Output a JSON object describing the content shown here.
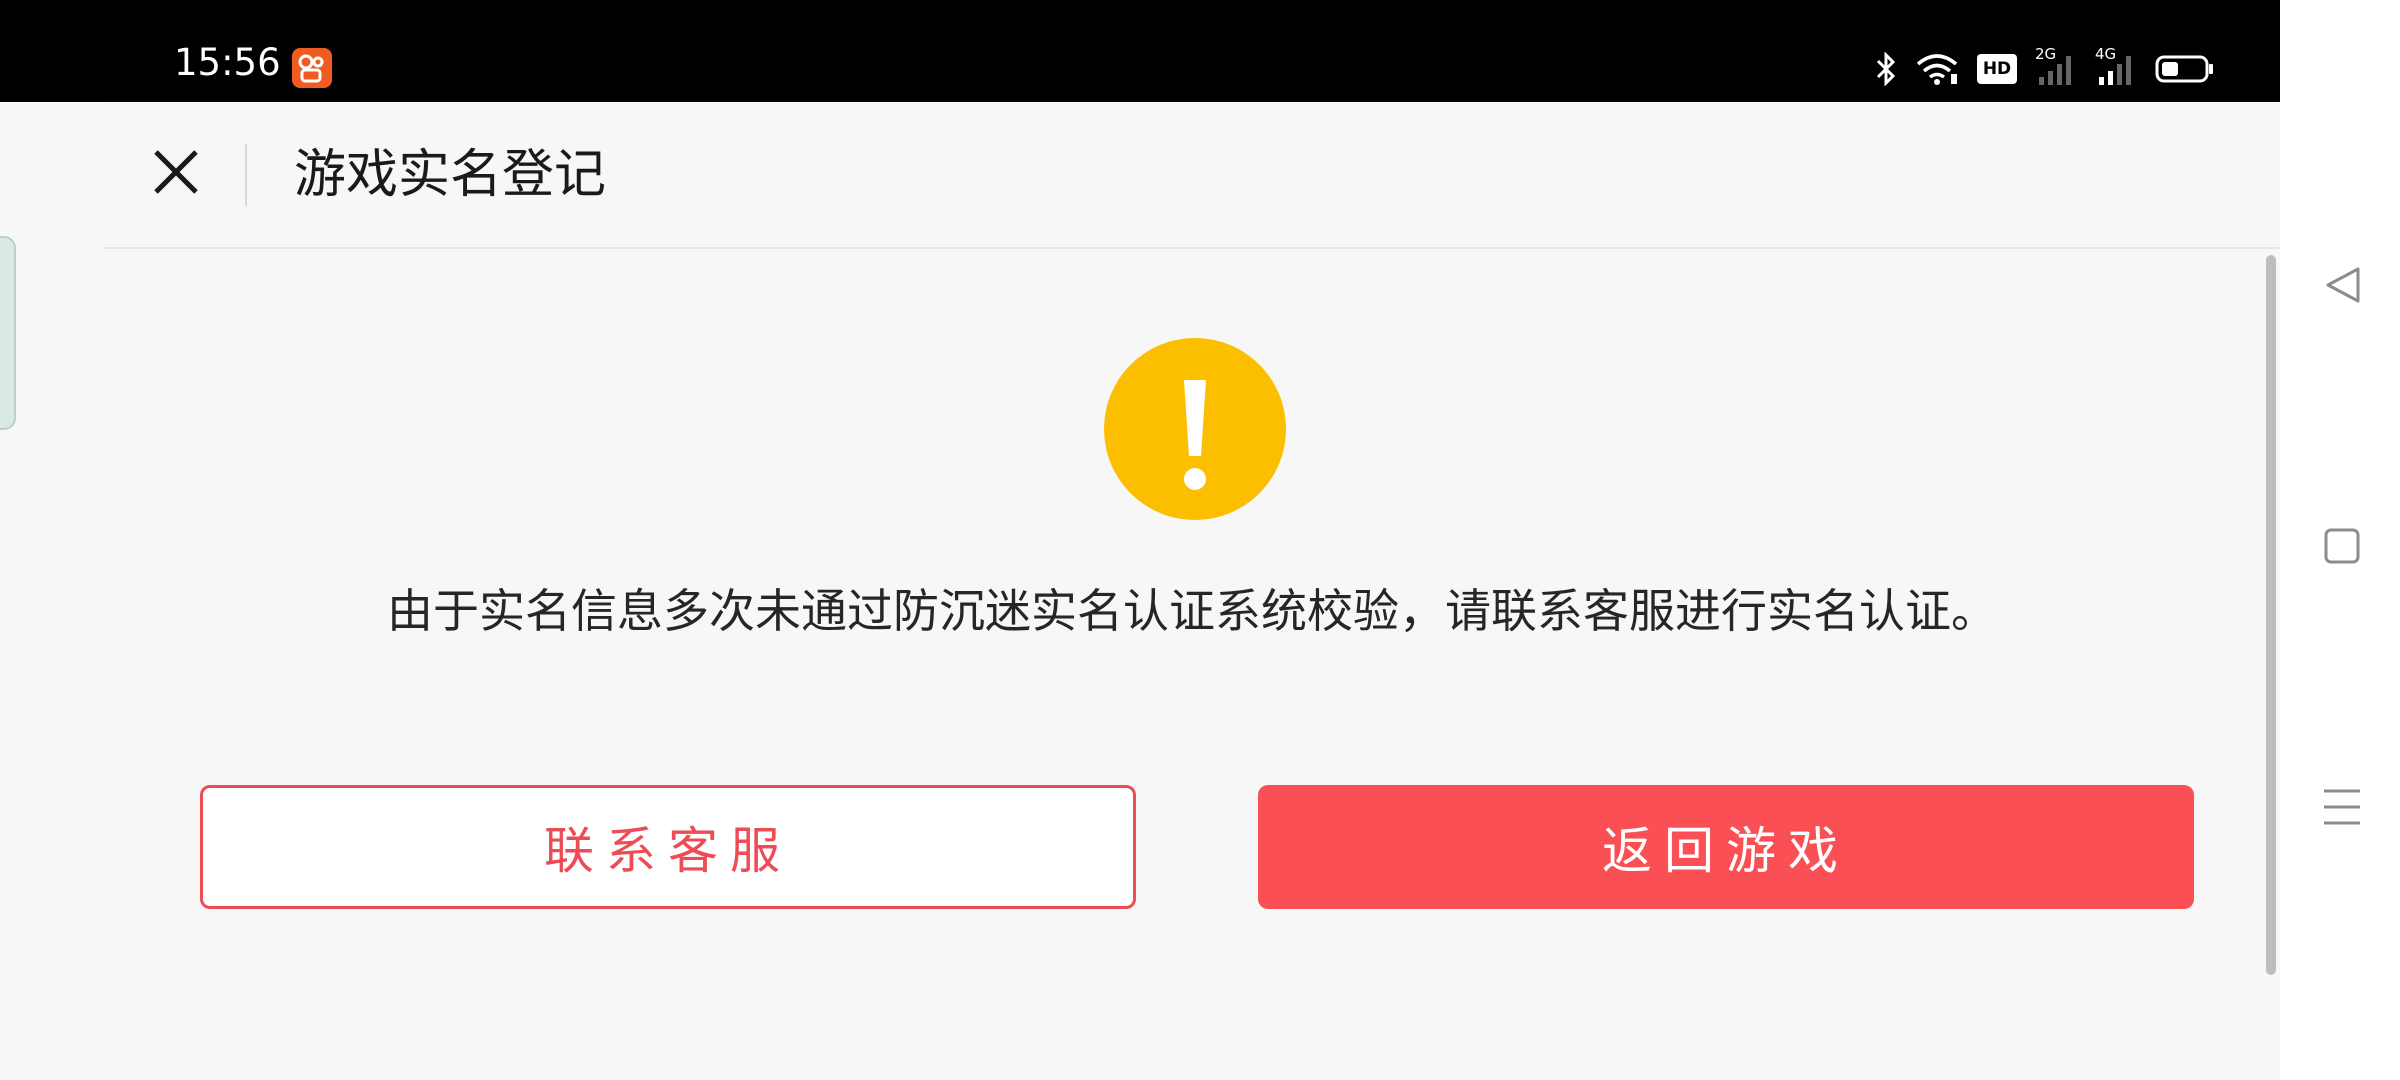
{
  "status_bar": {
    "time": "15:56",
    "app_icon": "kuaishou-app-icon",
    "icons": [
      "bluetooth-icon",
      "wifi-icon",
      "hd-icon",
      "signal-2g-icon",
      "signal-4g-icon",
      "battery-icon"
    ],
    "hd_label": "HD",
    "signal_2g_label": "2G",
    "signal_4g_label": "4G"
  },
  "header": {
    "title": "游戏实名登记",
    "close_icon": "close-icon"
  },
  "dialog": {
    "icon": "warning-icon",
    "accent_color": "#fbbf00",
    "message": "由于实名信息多次未通过防沉迷实名认证系统校验，请联系客服进行实名认证。",
    "buttons": {
      "contact_label": "联系客服",
      "back_label": "返回游戏"
    },
    "primary_color": "#fa5055"
  },
  "nav_bar": {
    "icons": [
      "back-triangle-icon",
      "home-square-icon",
      "menu-lines-icon"
    ]
  }
}
